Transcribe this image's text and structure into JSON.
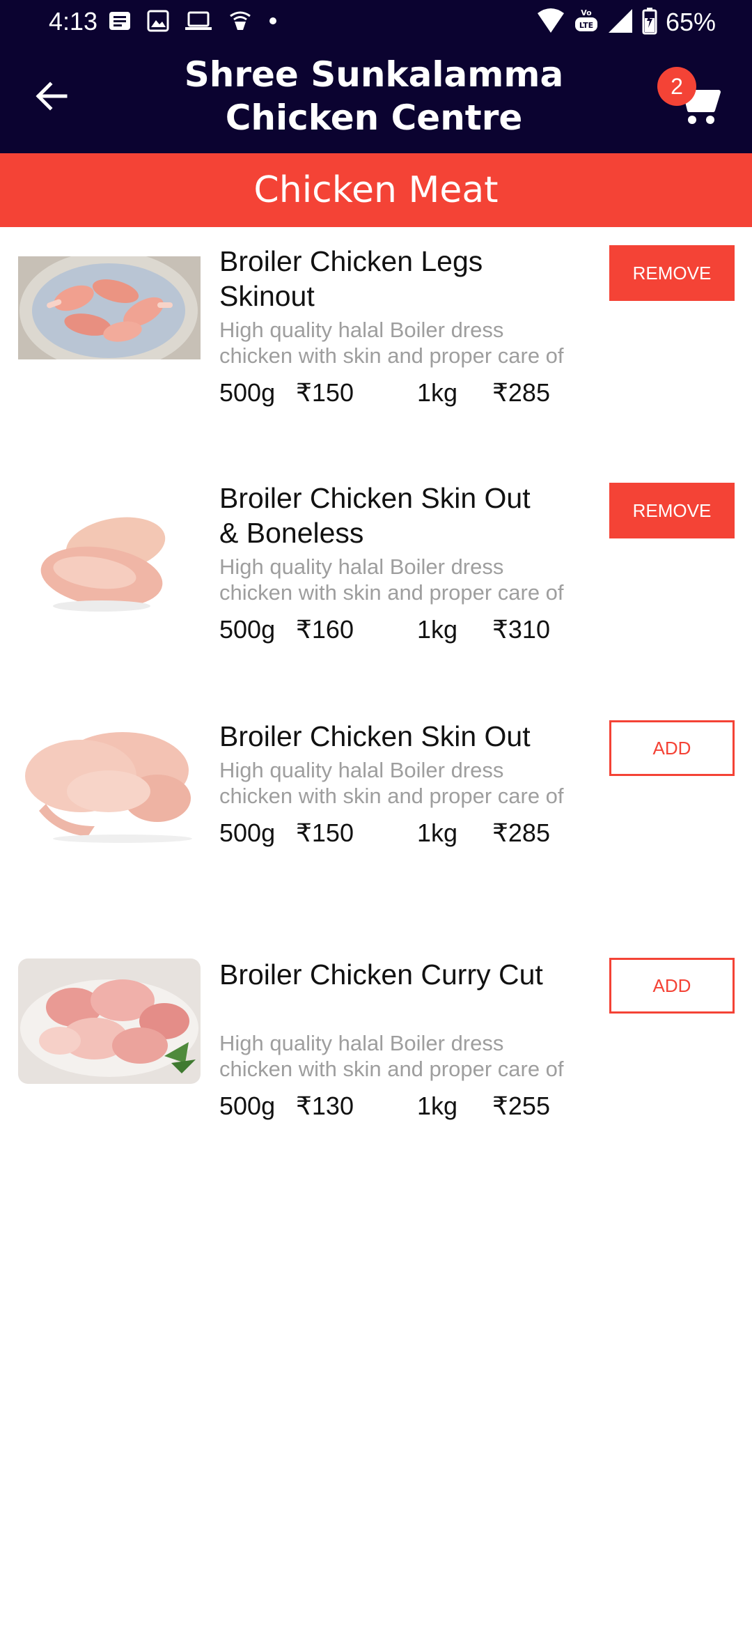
{
  "status_bar": {
    "time": "4:13",
    "battery": "65%",
    "icons": [
      "notification-icon",
      "image-icon",
      "laptop-icon",
      "cast-icon",
      "dot-icon",
      "wifi-icon",
      "volte-icon",
      "signal-icon",
      "battery-icon"
    ]
  },
  "app_bar": {
    "title": "Shree Sunkalamma Chicken Centre",
    "cart_count": "2",
    "colors": {
      "background": "#0b0330",
      "accent": "#f44336"
    }
  },
  "category": {
    "title": "Chicken Meat"
  },
  "products": [
    {
      "name": "Broiler Chicken Legs Skinout",
      "description": "High quality halal Boiler dress chicken with skin and proper care of",
      "weight1": "500g",
      "price1": "₹150",
      "weight2": "1kg",
      "price2": "₹285",
      "button": "REMOVE"
    },
    {
      "name": "Broiler Chicken Skin Out & Boneless",
      "description": "High quality halal Boiler dress chicken with skin and proper care of",
      "weight1": "500g",
      "price1": "₹160",
      "weight2": "1kg",
      "price2": "₹310",
      "button": "REMOVE"
    },
    {
      "name": "Broiler Chicken Skin Out",
      "description": "High quality halal Boiler dress chicken with skin and proper care of",
      "weight1": "500g",
      "price1": "₹150",
      "weight2": "1kg",
      "price2": "₹285",
      "button": "ADD"
    },
    {
      "name": "Broiler Chicken Curry Cut",
      "description": "High quality halal Boiler dress chicken with skin and proper care of",
      "weight1": "500g",
      "price1": "₹130",
      "weight2": "1kg",
      "price2": "₹255",
      "button": "ADD"
    }
  ]
}
